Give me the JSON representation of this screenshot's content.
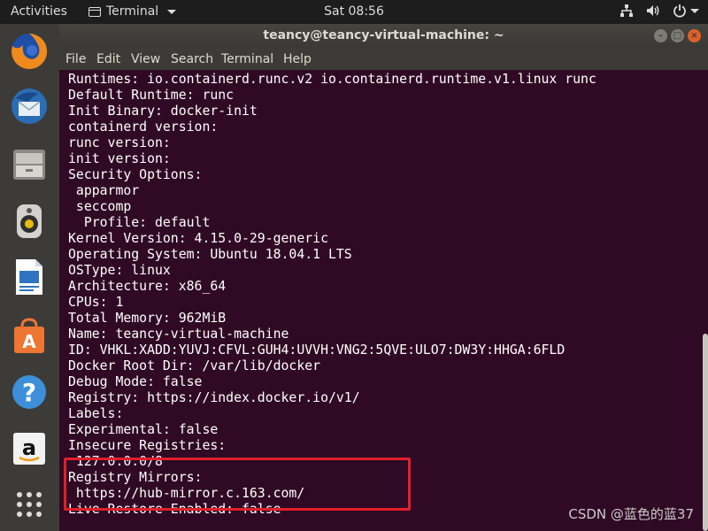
{
  "topbar": {
    "activities": "Activities",
    "app_name": "Terminal",
    "clock": "Sat 08:56"
  },
  "dock": {
    "items": [
      {
        "name": "firefox"
      },
      {
        "name": "thunderbird"
      },
      {
        "name": "files"
      },
      {
        "name": "rhythmbox"
      },
      {
        "name": "libreoffice-writer"
      },
      {
        "name": "ubuntu-software"
      },
      {
        "name": "help"
      },
      {
        "name": "amazon"
      },
      {
        "name": "show-applications"
      }
    ]
  },
  "window": {
    "title": "teancy@teancy-virtual-machine: ~",
    "menu": [
      "File",
      "Edit",
      "View",
      "Search",
      "Terminal",
      "Help"
    ]
  },
  "terminal": {
    "lines": [
      "Runtimes: io.containerd.runc.v2 io.containerd.runtime.v1.linux runc",
      "Default Runtime: runc",
      "Init Binary: docker-init",
      "containerd version:",
      "runc version:",
      "init version:",
      "Security Options:",
      " apparmor",
      " seccomp",
      "  Profile: default",
      "Kernel Version: 4.15.0-29-generic",
      "Operating System: Ubuntu 18.04.1 LTS",
      "OSType: linux",
      "Architecture: x86_64",
      "CPUs: 1",
      "Total Memory: 962MiB",
      "Name: teancy-virtual-machine",
      "ID: VHKL:XADD:YUVJ:CFVL:GUH4:UVVH:VNG2:5QVE:ULO7:DW3Y:HHGA:6FLD",
      "Docker Root Dir: /var/lib/docker",
      "Debug Mode: false",
      "Registry: https://index.docker.io/v1/",
      "Labels:",
      "Experimental: false",
      "Insecure Registries:",
      " 127.0.0.0/8",
      "Registry Mirrors:",
      " https://hub-mirror.c.163.com/",
      "Live Restore Enabled: false"
    ]
  },
  "watermark": "CSDN @蓝色的蓝37"
}
